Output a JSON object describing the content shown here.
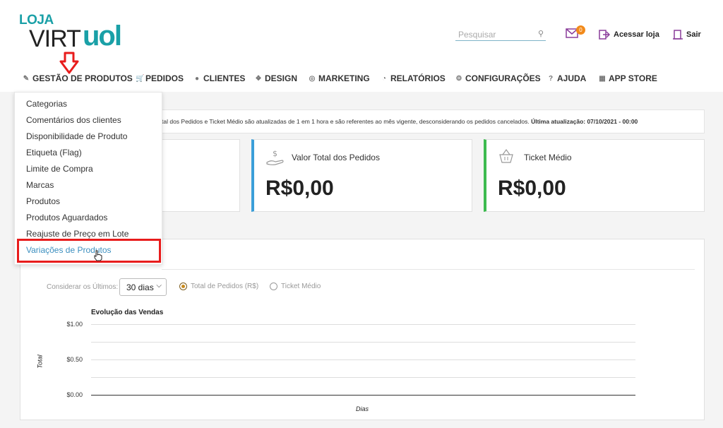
{
  "logo": {
    "top": "LOJA",
    "virt": "VIRT",
    "uol": "uol"
  },
  "search": {
    "placeholder": "Pesquisar",
    "icon": "search-icon"
  },
  "header": {
    "notifications_count": "0",
    "access_store": "Acessar loja",
    "logout": "Sair"
  },
  "nav": {
    "items": [
      {
        "label": "GESTÃO DE PRODUTOS",
        "icon": "edit-icon"
      },
      {
        "label": "PEDIDOS",
        "icon": "cart-icon"
      },
      {
        "label": "CLIENTES",
        "icon": "user-icon"
      },
      {
        "label": "DESIGN",
        "icon": "design-icon"
      },
      {
        "label": "MARKETING",
        "icon": "marketing-icon"
      },
      {
        "label": "RELATÓRIOS",
        "icon": "pie-chart-icon"
      },
      {
        "label": "CONFIGURAÇÕES",
        "icon": "gears-icon"
      },
      {
        "label": "AJUDA",
        "icon": "help-icon"
      },
      {
        "label": "APP STORE",
        "icon": "store-icon"
      }
    ]
  },
  "dropdown": {
    "items": [
      "Categorias",
      "Comentários dos clientes",
      "Disponibilidade de Produto",
      "Etiqueta (Flag)",
      "Limite de Compra",
      "Marcas",
      "Produtos",
      "Produtos Aguardados",
      "Reajuste de Preço em Lote",
      "Variações de Produtos"
    ],
    "active_index": 9
  },
  "notice": {
    "text": "tal dos Pedidos e Ticket Médio são atualizadas de 1 em 1 hora e são referentes ao mês vigente, desconsiderando os pedidos cancelados.",
    "last_update": "Última atualização: 07/10/2021 - 00:00"
  },
  "cards": [
    {
      "title": "Valor Total dos Pedidos",
      "value": "R$0,00",
      "accent": "#3b9fd9",
      "icon": "money-hand-icon"
    },
    {
      "title": "Ticket Médio",
      "value": "R$0,00",
      "accent": "#3dbb4f",
      "icon": "basket-icon"
    }
  ],
  "filters": {
    "label": "Considerar os Últimos:",
    "period": "30 dias",
    "radio_total": "Total de Pedidos (R$)",
    "radio_ticket": "Ticket Médio",
    "selected": "radio_total"
  },
  "chart_data": {
    "type": "line",
    "title": "Evolução das Vendas",
    "xlabel": "Dias",
    "ylabel": "Total",
    "y_ticks": [
      "$1.00",
      "$0.50",
      "$0.00"
    ],
    "ylim": [
      0,
      1
    ],
    "series": [],
    "grid": true
  },
  "colors": {
    "brand": "#1aa0a7",
    "highlight": "#e81c1c",
    "badge": "#f28a1a"
  }
}
